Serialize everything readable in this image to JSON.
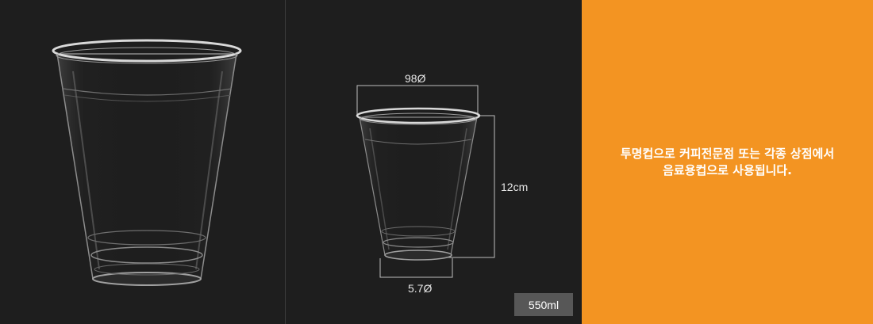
{
  "product": {
    "capacity": "550ml",
    "dimensions": {
      "top_diameter": "98Ø",
      "height": "12cm",
      "bottom_diameter": "5.7Ø"
    }
  },
  "description": {
    "line1": "투명컵으로 커피전문점 또는 각종 상점에서",
    "line2": "음료용컵으로 사용됩니다."
  },
  "colors": {
    "background": "#1e1e1e",
    "accent": "#f39422",
    "badge": "#575757"
  }
}
